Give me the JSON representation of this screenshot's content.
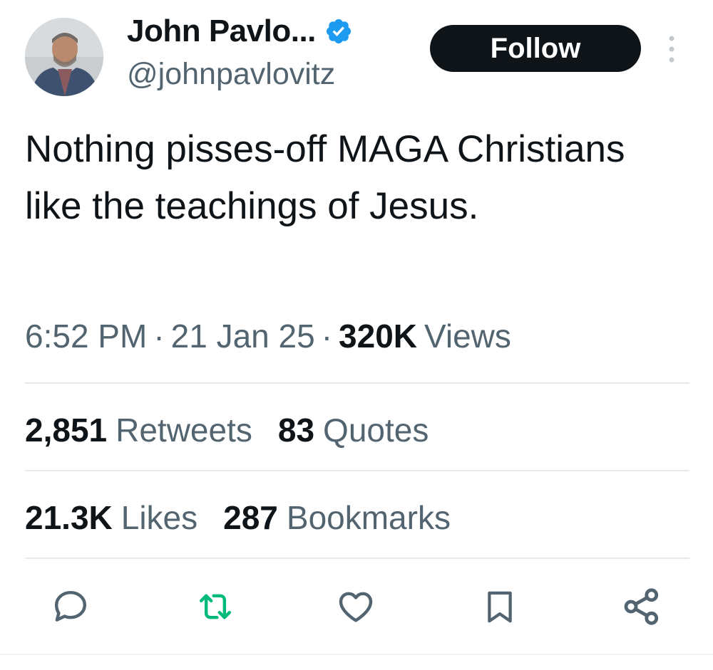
{
  "author": {
    "display_name": "John Pavlo...",
    "handle": "@johnpavlovitz",
    "avatar_icon": "profile-photo",
    "verified_icon": "verified-badge-icon",
    "verified_color": "#1d9bf0"
  },
  "follow_label": "Follow",
  "tweet": {
    "text": "Nothing pisses-off MAGA Christians like the teachings of Jesus.",
    "time": "6:52 PM",
    "separator": "·",
    "date": "21 Jan 25",
    "views_count": "320K",
    "views_label": "Views"
  },
  "stats": {
    "retweets": {
      "count": "2,851",
      "label": "Retweets"
    },
    "quotes": {
      "count": "83",
      "label": "Quotes"
    },
    "likes": {
      "count": "21.3K",
      "label": "Likes"
    },
    "bookmarks": {
      "count": "287",
      "label": "Bookmarks"
    }
  },
  "actions": [
    {
      "icon": "reply-icon"
    },
    {
      "icon": "retweet-icon",
      "color": "#00ba7c"
    },
    {
      "icon": "like-icon"
    },
    {
      "icon": "bookmark-icon"
    },
    {
      "icon": "share-icon"
    }
  ],
  "colors": {
    "text_primary": "#0f1419",
    "text_secondary": "#536471",
    "follow_bg": "#0f1419",
    "retweet_active": "#00ba7c"
  }
}
